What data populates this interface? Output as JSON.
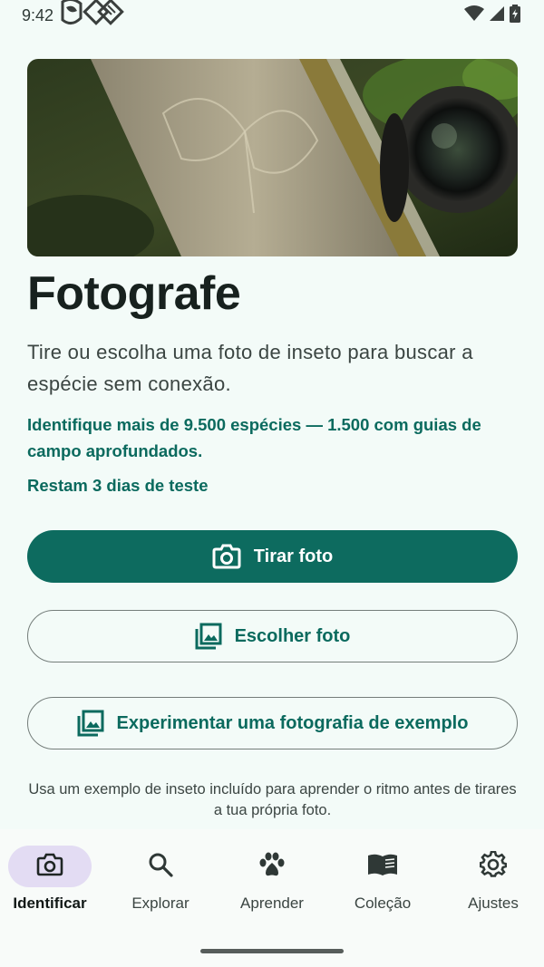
{
  "status_bar": {
    "time": "9:42",
    "icons": [
      "app-logo-icon",
      "wifi-icon",
      "signal-icon",
      "battery-icon"
    ]
  },
  "hero": {
    "image": "photo-of-embossed-notebook-and-camera-lens-on-moss"
  },
  "main": {
    "title": "Fotografe",
    "subtitle": "Tire ou escolha uma foto de inseto para buscar a espécie sem conexão.",
    "highlight": "Identifique mais de 9.500 espécies — 1.500 com guias de campo aprofundados.",
    "trial": "Restam 3 dias de teste",
    "take_photo_label": "Tirar foto",
    "choose_photo_label": "Escolher foto",
    "example_photo_label": "Experimentar uma fotografia de exemplo",
    "helper_text": "Usa um exemplo de inseto incluído para aprender o ritmo antes de tirares a tua própria foto."
  },
  "nav": {
    "items": [
      {
        "label": "Identificar",
        "icon": "camera-icon",
        "active": true
      },
      {
        "label": "Explorar",
        "icon": "search-icon",
        "active": false
      },
      {
        "label": "Aprender",
        "icon": "paw-icon",
        "active": false
      },
      {
        "label": "Coleção",
        "icon": "book-icon",
        "active": false
      },
      {
        "label": "Ajustes",
        "icon": "gear-icon",
        "active": false
      }
    ]
  },
  "colors": {
    "accent": "#0d6b5f",
    "accent_text": "#0b6a5e",
    "background": "#f3fbf8",
    "nav_active_pill": "#e3dcf3"
  }
}
